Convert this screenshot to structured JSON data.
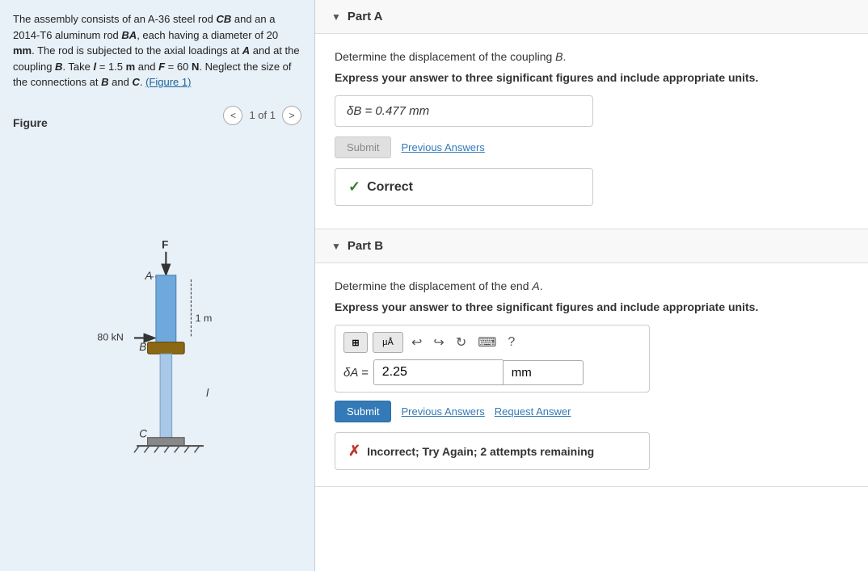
{
  "left": {
    "problem_text_parts": [
      "The assembly consists of an A-36 steel rod ",
      "CB",
      " and an a 2014-T6 aluminum rod ",
      "BA",
      ", each having a diameter of 20 ",
      "mm",
      ". The rod is subjected to the axial loadings at ",
      "A",
      " and at the coupling ",
      "B",
      ". Take ",
      "l",
      " = 1.5 ",
      "m",
      " and ",
      "F",
      " = 60 ",
      "N",
      ". Neglect the size of the connections at ",
      "B",
      " and ",
      "C",
      ". (Figure 1)"
    ],
    "figure_label": "Figure",
    "figure_nav": {
      "prev_label": "<",
      "count": "1 of 1",
      "next_label": ">"
    }
  },
  "parts": {
    "part_a": {
      "header": "Part A",
      "question": "Determine the displacement of the coupling B.",
      "instruction": "Express your answer to three significant figures and include appropriate units.",
      "answer_display": "δB =  0.477 mm",
      "submit_label": "Submit",
      "prev_answers_label": "Previous Answers",
      "correct_label": "Correct"
    },
    "part_b": {
      "header": "Part B",
      "question": "Determine the displacement of the end A.",
      "instruction": "Express your answer to three significant figures and include appropriate units.",
      "delta_label": "δA =",
      "value": "2.25",
      "unit": "mm",
      "submit_label": "Submit",
      "prev_answers_label": "Previous Answers",
      "request_answer_label": "Request Answer",
      "incorrect_label": "Incorrect; Try Again; 2 attempts remaining"
    }
  },
  "icons": {
    "grid_icon": "⊞",
    "mu_icon": "μÅ",
    "undo_icon": "↩",
    "redo_icon": "↪",
    "refresh_icon": "↻",
    "keyboard_icon": "⌨",
    "question_icon": "?"
  }
}
